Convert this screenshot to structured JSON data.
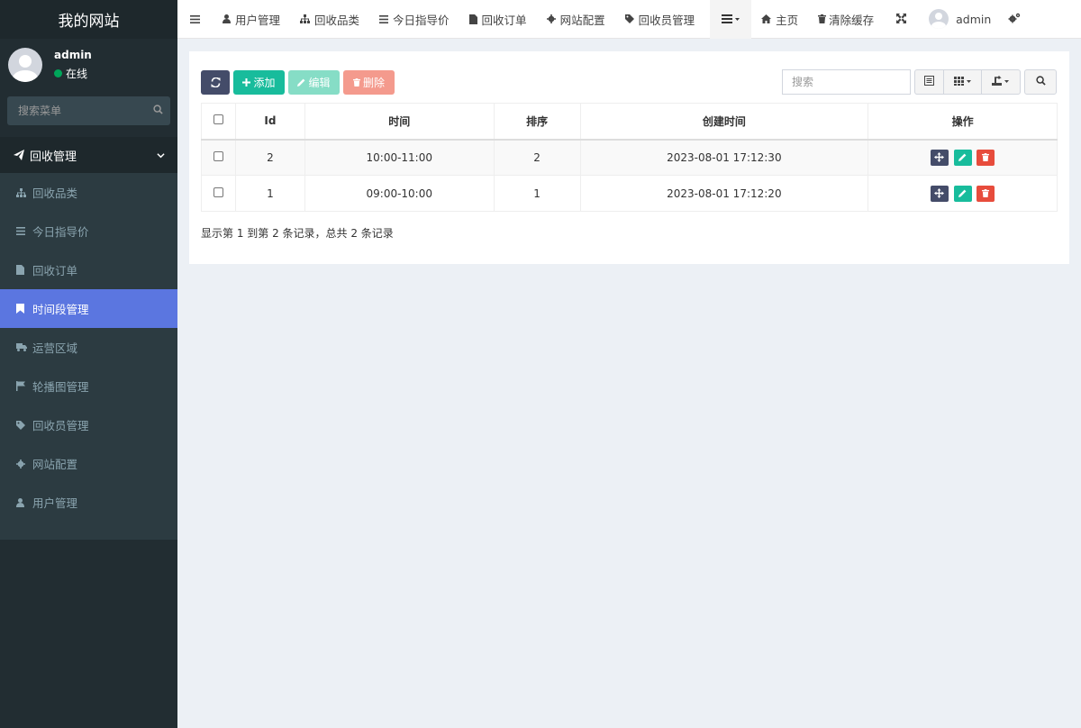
{
  "site_title": "我的网站",
  "user": {
    "name": "admin",
    "status": "在线"
  },
  "sidebar": {
    "search_placeholder": "搜索菜单",
    "header_label": "回收管理",
    "items": [
      {
        "label": "回收品类",
        "icon": "sitemap-icon"
      },
      {
        "label": "今日指导价",
        "icon": "list-icon"
      },
      {
        "label": "回收订单",
        "icon": "file-icon"
      },
      {
        "label": "时间段管理",
        "icon": "bookmark-icon",
        "active": true
      },
      {
        "label": "运营区域",
        "icon": "truck-icon"
      },
      {
        "label": "轮播图管理",
        "icon": "flag-icon"
      },
      {
        "label": "回收员管理",
        "icon": "tag-icon"
      },
      {
        "label": "网站配置",
        "icon": "gear-icon"
      },
      {
        "label": "用户管理",
        "icon": "user-icon"
      }
    ]
  },
  "navbar": {
    "tabs": [
      {
        "label": "用户管理",
        "icon": "user-icon"
      },
      {
        "label": "回收品类",
        "icon": "sitemap-icon"
      },
      {
        "label": "今日指导价",
        "icon": "list-icon"
      },
      {
        "label": "回收订单",
        "icon": "file-icon"
      },
      {
        "label": "网站配置",
        "icon": "gear-icon"
      },
      {
        "label": "回收员管理",
        "icon": "tag-icon"
      }
    ],
    "home_label": "主页",
    "clear_cache_label": "清除缓存",
    "user_label": "admin"
  },
  "toolbar": {
    "add_label": "添加",
    "edit_label": "编辑",
    "delete_label": "删除",
    "search_placeholder": "搜索"
  },
  "table": {
    "columns": [
      "Id",
      "时间",
      "排序",
      "创建时间",
      "操作"
    ],
    "rows": [
      {
        "id": "2",
        "time": "10:00-11:00",
        "sort": "2",
        "created": "2023-08-01 17:12:30"
      },
      {
        "id": "1",
        "time": "09:00-10:00",
        "sort": "1",
        "created": "2023-08-01 17:12:20"
      }
    ]
  },
  "pagination": {
    "info": "显示第 1 到第 2 条记录，总共 2 条记录"
  },
  "colors": {
    "sidebar_bg": "#222d32",
    "active_menu": "#5b76e0",
    "success": "#18bc9c",
    "danger": "#e74c3c",
    "primary_dark": "#444c69"
  }
}
